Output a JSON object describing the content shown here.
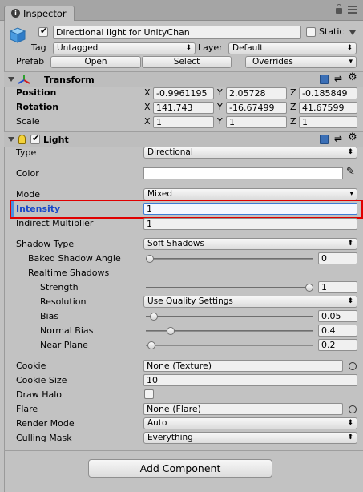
{
  "tab": {
    "label": "Inspector"
  },
  "header": {
    "object_name": "Directional light for UnityChan",
    "static_label": "Static",
    "tag_label": "Tag",
    "tag_value": "Untagged",
    "layer_label": "Layer",
    "layer_value": "Default",
    "prefab_label": "Prefab",
    "open_label": "Open",
    "select_label": "Select",
    "overrides_label": "Overrides"
  },
  "transform": {
    "title": "Transform",
    "position_label": "Position",
    "rotation_label": "Rotation",
    "scale_label": "Scale",
    "x": "X",
    "y": "Y",
    "z": "Z",
    "position": [
      "-0.9961195",
      "2.05728",
      "-0.185849"
    ],
    "rotation": [
      "141.743",
      "-16.67499",
      "41.67599"
    ],
    "scale": [
      "1",
      "1",
      "1"
    ]
  },
  "light": {
    "title": "Light",
    "type_label": "Type",
    "type_value": "Directional",
    "color_label": "Color",
    "mode_label": "Mode",
    "mode_value": "Mixed",
    "intensity_label": "Intensity",
    "intensity_value": "1",
    "indirect_label": "Indirect Multiplier",
    "indirect_value": "1",
    "shadow_type_label": "Shadow Type",
    "shadow_type_value": "Soft Shadows",
    "baked_angle_label": "Baked Shadow Angle",
    "baked_angle_value": "0",
    "realtime_label": "Realtime Shadows",
    "strength_label": "Strength",
    "strength_value": "1",
    "resolution_label": "Resolution",
    "resolution_value": "Use Quality Settings",
    "bias_label": "Bias",
    "bias_value": "0.05",
    "normal_bias_label": "Normal Bias",
    "normal_bias_value": "0.4",
    "near_plane_label": "Near Plane",
    "near_plane_value": "0.2",
    "cookie_label": "Cookie",
    "cookie_value": "None (Texture)",
    "cookie_size_label": "Cookie Size",
    "cookie_size_value": "10",
    "draw_halo_label": "Draw Halo",
    "flare_label": "Flare",
    "flare_value": "None (Flare)",
    "render_mode_label": "Render Mode",
    "render_mode_value": "Auto",
    "culling_label": "Culling Mask",
    "culling_value": "Everything"
  },
  "sliders": {
    "baked_angle": 0,
    "strength": 1,
    "bias": 0.025,
    "normal_bias": 0.13,
    "near_plane": 0.01
  },
  "add_component_label": "Add Component",
  "colors": {
    "highlight_box": "#e00000",
    "intensity_label": "#1a48c9",
    "color_swatch": "#ffffff"
  }
}
